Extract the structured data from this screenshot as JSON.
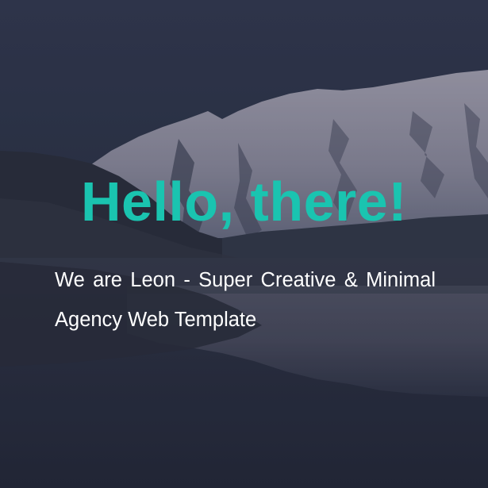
{
  "hero": {
    "title": "Hello, there!",
    "subtitle": "We are Leon - Super Creative & Minimal Agency Web Template"
  },
  "colors": {
    "accent": "#1ac4b0",
    "text": "#ffffff",
    "background": "#2b3144"
  }
}
